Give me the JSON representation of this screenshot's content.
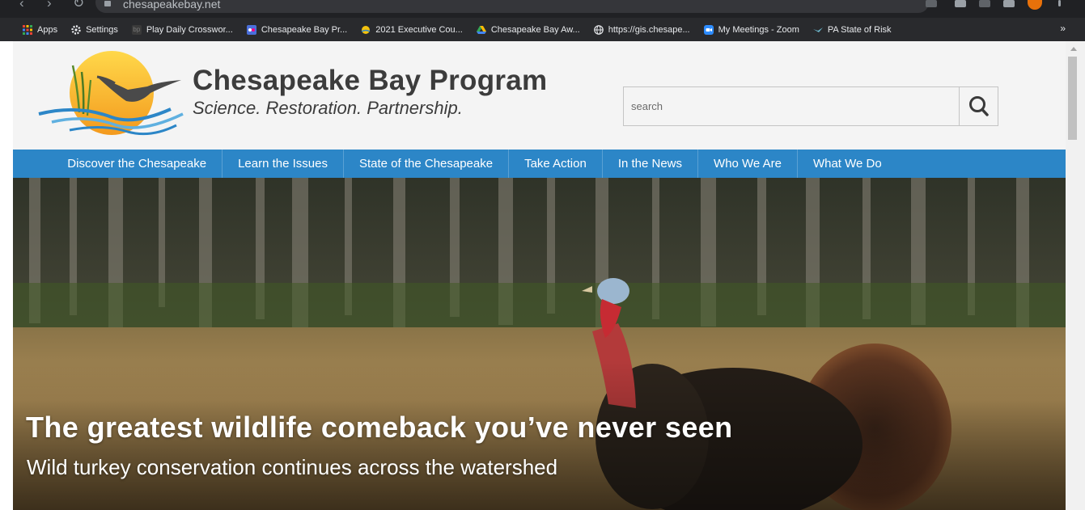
{
  "browser": {
    "url": "chesapeakebay.net",
    "bookmarks": [
      {
        "label": "Apps",
        "icon": "apps-grid-icon",
        "color": "#ea4335"
      },
      {
        "label": "Settings",
        "icon": "gear-icon",
        "color": "#e8eaed"
      },
      {
        "label": "Play Daily Crosswor...",
        "icon": "bp-icon",
        "color": "#555555"
      },
      {
        "label": "Chesapeake Bay Pr...",
        "icon": "flickr-icon",
        "color": "#4a6fdb"
      },
      {
        "label": "2021 Executive Cou...",
        "icon": "cb-icon",
        "color": "#f4c20d"
      },
      {
        "label": "Chesapeake Bay Aw...",
        "icon": "drive-icon",
        "color": "#34a853"
      },
      {
        "label": "https://gis.chesape...",
        "icon": "globe-icon",
        "color": "#e8eaed"
      },
      {
        "label": "My Meetings - Zoom",
        "icon": "zoom-icon",
        "color": "#2d8cff"
      },
      {
        "label": "PA State of Risk",
        "icon": "bird-icon",
        "color": "#6bb4c9"
      }
    ],
    "more_label": "»"
  },
  "site": {
    "title": "Chesapeake Bay Program",
    "tagline": "Science. Restoration. Partnership.",
    "search_placeholder": "search"
  },
  "nav": [
    "Discover the Chesapeake",
    "Learn the Issues",
    "State of the Chesapeake",
    "Take Action",
    "In the News",
    "Who We Are",
    "What We Do"
  ],
  "hero": {
    "title": "The greatest wildlife comeback you’ve never seen",
    "subtitle": "Wild turkey conservation continues across the watershed"
  },
  "colors": {
    "nav_bar": "#2c86c7",
    "header_bg": "#f4f4f4",
    "browser_bg": "#202124"
  }
}
